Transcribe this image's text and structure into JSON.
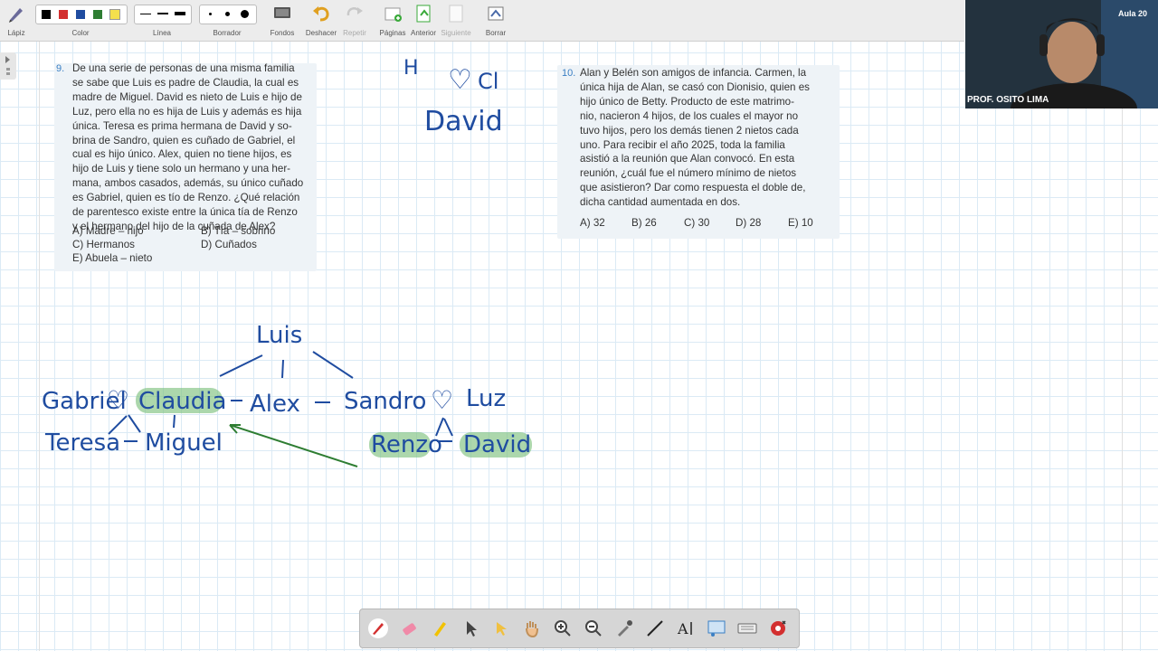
{
  "toolbar": {
    "pen": "Lápiz",
    "color": "Color",
    "line": "Línea",
    "eraser": "Borrador",
    "backgrounds": "Fondos",
    "undo": "Deshacer",
    "redo": "Repetir",
    "pages": "Páginas",
    "previous": "Anterior",
    "next": "Siguiente",
    "clear": "Borrar",
    "swatches": [
      "#000000",
      "#d32f2f",
      "#1f4ca0",
      "#2e7d32",
      "#f4e04d"
    ]
  },
  "q9": {
    "number": "9.",
    "lines": [
      "De una serie de personas de una misma familia",
      "se sabe que Luis es padre de Claudia, la cual es",
      "madre de Miguel. David es nieto de Luis e hijo de",
      "Luz, pero ella no es hija de Luis y además es hija",
      "única. Teresa es prima hermana de David y so-",
      "brina de Sandro, quien es cuñado de Gabriel, el",
      "cual es hijo único. Alex, quien no tiene hijos, es",
      "hijo de Luis y tiene solo un hermano y una her-",
      "mana, ambos casados, además, su único cuñado",
      "es Gabriel, quien es tío de Renzo. ¿Qué relación",
      "de parentesco existe entre la única tía de Renzo",
      "y el hermano del hijo de la cuñada de Alex?"
    ],
    "options": {
      "a": "A)  Madre – hijo",
      "b": "B)  Tía – sobrino",
      "c": "C)  Hermanos",
      "d": "D)  Cuñados",
      "e": "E)  Abuela – nieto"
    }
  },
  "q10": {
    "number": "10.",
    "lines": [
      "Alan y Belén son amigos de infancia. Carmen, la",
      "única hija de Alan, se casó con Dionisio, quien es",
      "hijo único de Betty. Producto de este matrimo-",
      "nio, nacieron 4 hijos, de los cuales el mayor no",
      "tuvo hijos, pero los demás tienen 2 nietos cada",
      "uno. Para recibir el año 2025, toda la familia",
      "asistió a la reunión que Alan convocó. En esta",
      "reunión, ¿cuál fue el número mínimo de nietos",
      "que asistieron? Dar como respuesta el doble de,",
      "dicha cantidad aumentada en dos."
    ],
    "options": {
      "a": "A)  32",
      "b": "B)  26",
      "c": "C)  30",
      "d": "D)  28",
      "e": "E)  10"
    }
  },
  "handwriting": {
    "top_h": "H",
    "top_heart": "♡",
    "top_clau": "Cl",
    "top_clau_hand": "Cl",
    "top_david": "David",
    "luis": "Luis",
    "gabriel": "Gabriel",
    "claudia": "Claudia",
    "alex": "Alex",
    "sandro": "Sandro",
    "luz": "Luz",
    "teresa": "Teresa",
    "miguel": "Miguel",
    "renzo": "Renzo",
    "david": "David"
  },
  "video": {
    "label": "PROF. OSITO LIMA",
    "brand": "Aula 20"
  },
  "colors": {
    "ink_blue": "#1f4ca0",
    "highlight_green": "#7fc27f",
    "arrow_green": "#2e7d32",
    "grid": "#dbeaf5"
  }
}
